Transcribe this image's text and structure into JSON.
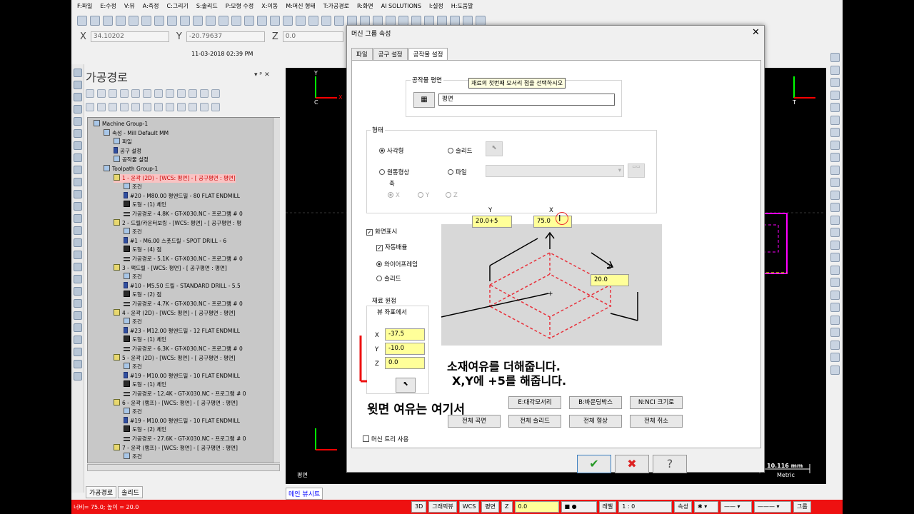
{
  "menu": [
    "F:파일",
    "E:수정",
    "V:뷰",
    "A:측정",
    "C:그리기",
    "S:솔리드",
    "P:모형 수정",
    "X:이동",
    "M:머신 형태",
    "T:가공경로",
    "R:화면",
    "AI SOLUTIONS",
    "I:설정",
    "H:도움말"
  ],
  "coords": {
    "x_label": "X",
    "x_value": "34.10202",
    "y_label": "Y",
    "y_value": "-20.79637",
    "z_label": "Z",
    "z_value": "0.0"
  },
  "timestamp": "11-03-2018 02:39 PM",
  "panel": {
    "title": "가공경로",
    "controls": "▾ ᵖ ✕"
  },
  "tree": [
    {
      "indent": 0,
      "icon": "group",
      "text": "Machine Group-1"
    },
    {
      "indent": 1,
      "icon": "machine",
      "text": "속성 - Mill Default MM"
    },
    {
      "indent": 2,
      "icon": "folder",
      "text": "파일"
    },
    {
      "indent": 2,
      "icon": "tool",
      "text": "공구 설정"
    },
    {
      "indent": 2,
      "icon": "stock",
      "text": "공작물 설정"
    },
    {
      "indent": 1,
      "icon": "group",
      "text": "Toolpath Group-1"
    },
    {
      "indent": 2,
      "icon": "op",
      "text": "1 - 윤곽 (2D) - [WCS: 평면] - [ 공구평면 : 평면]",
      "selected": true
    },
    {
      "indent": 3,
      "icon": "folder",
      "text": "조건"
    },
    {
      "indent": 3,
      "icon": "tool",
      "text": "#20 - M80.00 평엔드밀 - 80 FLAT ENDMILL"
    },
    {
      "indent": 3,
      "icon": "geo",
      "text": "도형 - (1) 체인"
    },
    {
      "indent": 3,
      "icon": "nc",
      "text": "가공경로 - 4.8K - GT-X030.NC - 프로그램 # 0"
    },
    {
      "indent": 2,
      "icon": "op",
      "text": "2 - 드릴/카운터보링 - [WCS: 평면] - [ 공구평면 : 평"
    },
    {
      "indent": 3,
      "icon": "folder",
      "text": "조건"
    },
    {
      "indent": 3,
      "icon": "tool",
      "text": "#1 - M6.00 스폿드릴 - SPOT DRILL - 6"
    },
    {
      "indent": 3,
      "icon": "geo",
      "text": "도형 - (4) 점"
    },
    {
      "indent": 3,
      "icon": "nc",
      "text": "가공경로 - 5.1K - GT-X030.NC - 프로그램 # 0"
    },
    {
      "indent": 2,
      "icon": "op",
      "text": "3 - 팩드릴 - [WCS: 평면] - [ 공구평면 : 평면]"
    },
    {
      "indent": 3,
      "icon": "folder",
      "text": "조건"
    },
    {
      "indent": 3,
      "icon": "tool",
      "text": "#10 - M5.50 드릴 - STANDARD DRILL - 5.5"
    },
    {
      "indent": 3,
      "icon": "geo",
      "text": "도형 - (2) 점"
    },
    {
      "indent": 3,
      "icon": "nc",
      "text": "가공경로 - 4.7K - GT-X030.NC - 프로그램 # 0"
    },
    {
      "indent": 2,
      "icon": "op",
      "text": "4 - 윤곽 (2D) - [WCS: 평면] - [ 공구평면 : 평면]"
    },
    {
      "indent": 3,
      "icon": "folder",
      "text": "조건"
    },
    {
      "indent": 3,
      "icon": "tool",
      "text": "#23 - M12.00 평엔드밀 - 12 FLAT ENDMILL"
    },
    {
      "indent": 3,
      "icon": "geo",
      "text": "도형 - (1) 체인"
    },
    {
      "indent": 3,
      "icon": "nc",
      "text": "가공경로 - 6.3K - GT-X030.NC - 프로그램 # 0"
    },
    {
      "indent": 2,
      "icon": "op",
      "text": "5 - 윤곽 (2D) - [WCS: 평면] - [ 공구평면 : 평면]"
    },
    {
      "indent": 3,
      "icon": "folder",
      "text": "조건"
    },
    {
      "indent": 3,
      "icon": "tool",
      "text": "#19 - M10.00 평엔드밀 - 10 FLAT ENDMILL"
    },
    {
      "indent": 3,
      "icon": "geo",
      "text": "도형 - (1) 체인"
    },
    {
      "indent": 3,
      "icon": "nc",
      "text": "가공경로 - 12.4K - GT-X030.NC - 프로그램 # 0"
    },
    {
      "indent": 2,
      "icon": "op",
      "text": "6 - 윤곽 (램프) - [WCS: 평면] - [ 공구평면 : 평면]"
    },
    {
      "indent": 3,
      "icon": "folder",
      "text": "조건"
    },
    {
      "indent": 3,
      "icon": "tool",
      "text": "#19 - M10.00 평엔드밀 - 10 FLAT ENDMILL"
    },
    {
      "indent": 3,
      "icon": "geo",
      "text": "도형 - (2) 체인"
    },
    {
      "indent": 3,
      "icon": "nc",
      "text": "가공경로 - 27.6K - GT-X030.NC - 프로그램 # 0"
    },
    {
      "indent": 2,
      "icon": "op",
      "text": "7 - 윤곽 (램프) - [WCS: 평면] - [ 공구평면 : 평면]"
    },
    {
      "indent": 3,
      "icon": "folder",
      "text": "조건"
    }
  ],
  "bottom_tabs": {
    "toolpaths": "가공경로",
    "solids": "솔리드"
  },
  "viewport": {
    "tab": "메인 뷰시트",
    "plane_label": "평면",
    "scale_value": "10.116 mm",
    "scale_unit": "Metric",
    "axis_left_c": "C",
    "axis_right_t": "T",
    "axis_y": "Y",
    "axis_x": "X"
  },
  "dialog": {
    "title": "머신 그룹 속성",
    "close": "✕",
    "tabs": [
      "파일",
      "공구 설정",
      "공작물 설정"
    ],
    "stock_plane_group": "공작물 평면",
    "stock_plane_value": "평면",
    "tooltip": "재료의 첫번째 모서리 점을 선택하시오",
    "shape_group": "형태",
    "rect": "사각형",
    "solid": "솔리드",
    "cylinder": "원통형상",
    "file": "파일",
    "axis_label": "축",
    "ax_x": "X",
    "ax_y": "Y",
    "ax_z": "Z",
    "display": "화면표시",
    "fit": "자동배율",
    "wireframe": "와이어프레임",
    "solid2": "솔리드",
    "origin_group": "재료 원점",
    "origin_view": "뷰 좌표에서",
    "ox_label": "X",
    "ox": "-37.5",
    "oy_label": "Y",
    "oy": "-10.0",
    "oz_label": "Z",
    "oz": "0.0",
    "dim_y": "20.0+5",
    "dim_x": "75.0",
    "dim_z": "20.0",
    "pv_y": "Y",
    "pv_x": "X",
    "pv_z": "Z",
    "btn_corners": "E:대각모서리",
    "btn_bbox": "B:바운딩박스",
    "btn_nci": "N:NCI 크기로",
    "btn_all_surf": "전체 곡면",
    "btn_all_solid": "전체 솔리드",
    "btn_all_shape": "전체 형상",
    "btn_cancel_all": "전체 취소",
    "machine_tree": "머신 트리 사용",
    "ok": "✔",
    "cancel": "✖",
    "help": "?"
  },
  "annotations": {
    "note1": "소재여유를 더해줍니다.",
    "note2": "X,Y에 +5를 해줍니다.",
    "note3": "윗면 여유는 여기서"
  },
  "status": {
    "left": "너비= 75.0; 높이 = 20.0",
    "b3d": "3D",
    "graphic": "그래픽뷰",
    "wcs": "WCS",
    "plane": "평면",
    "z": "Z",
    "z_value": "0.0",
    "level_label": "레벨",
    "level": "1 : 0",
    "attr": "속성",
    "group": "그룹"
  },
  "colors": {
    "status_red": "#e11111",
    "selected_row": "#f9c3c3",
    "magenta": "#ff00ff",
    "dashed_red": "#e8323c",
    "yellow_field": "#ffff99"
  }
}
